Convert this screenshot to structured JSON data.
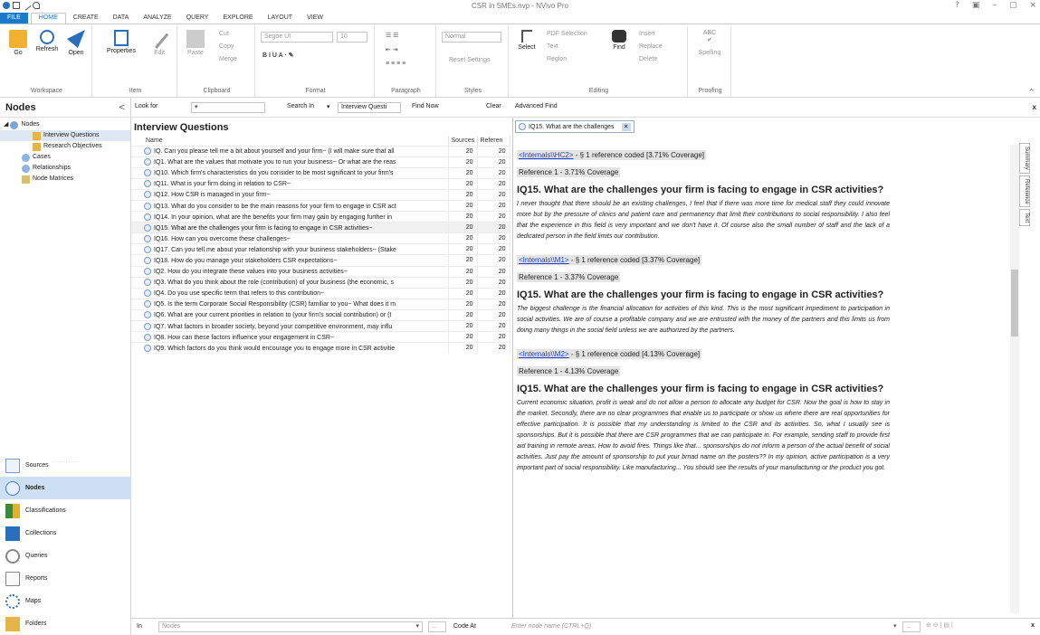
{
  "window": {
    "title": "CSR in SMEs.nvp - NVivo Pro",
    "controls": [
      "?",
      "▣",
      "–",
      "▢",
      "×"
    ]
  },
  "tabs": [
    "FILE",
    "HOME",
    "CREATE",
    "DATA",
    "ANALYZE",
    "QUERY",
    "EXPLORE",
    "LAYOUT",
    "VIEW"
  ],
  "ribbon": {
    "workspace": {
      "label": "Workspace",
      "go": "Go",
      "refresh": "Refresh",
      "open": "Open"
    },
    "item": {
      "label": "Item",
      "properties": "Properties",
      "edit": "Edit"
    },
    "clipboard": {
      "label": "Clipboard",
      "paste": "Paste",
      "cut": "Cut",
      "copy": "Copy",
      "merge": "Merge"
    },
    "format": {
      "label": "Format",
      "font": "Segoe UI",
      "size": "10"
    },
    "paragraph": {
      "label": "Paragraph"
    },
    "styles": {
      "label": "Styles",
      "style": "Normal",
      "reset": "Reset Settings"
    },
    "editing": {
      "label": "Editing",
      "select": "Select",
      "pdf_selection": "PDF Selection",
      "text": "Text",
      "region": "Region",
      "find": "Find",
      "insert": "Insert",
      "replace": "Replace",
      "delete": "Delete"
    },
    "proofing": {
      "label": "Proofing",
      "spelling": "Spelling",
      "abc": "ABC"
    }
  },
  "nav": {
    "title": "Nodes",
    "tree": [
      {
        "label": "Nodes",
        "level": 0
      },
      {
        "label": "Interview Questions",
        "level": 2
      },
      {
        "label": "Research Objectives",
        "level": 2
      },
      {
        "label": "Cases",
        "level": 1
      },
      {
        "label": "Relationships",
        "level": 1
      },
      {
        "label": "Node Matrices",
        "level": 1
      }
    ],
    "buttons": [
      "Sources",
      "Nodes",
      "Classifications",
      "Collections",
      "Queries",
      "Reports",
      "Maps",
      "Folders"
    ]
  },
  "findbar": {
    "look_for": "Look for",
    "search_in": "Search In",
    "search_value": "Interview Questi",
    "find_now": "Find Now",
    "clear": "Clear",
    "advanced": "Advanced Find",
    "close": "x"
  },
  "list": {
    "title": "Interview Questions",
    "columns": {
      "name": "Name",
      "sources": "Sources",
      "references": "Referen"
    },
    "rows": [
      {
        "name": "IQ. Can you please tell me a bit about yourself and your firm~ (I will make sure that all",
        "sources": "20",
        "refs": "20"
      },
      {
        "name": "IQ1. What are the values that motivate you to run your business~ Or what are the reas",
        "sources": "20",
        "refs": "20"
      },
      {
        "name": "IQ10. Which firm's characteristics do you consider to be most significant to your firm's",
        "sources": "20",
        "refs": "20"
      },
      {
        "name": "IQ11. What is your firm doing in relation to CSR~",
        "sources": "20",
        "refs": "20"
      },
      {
        "name": "IQ12. How CSR is managed in your firm~",
        "sources": "20",
        "refs": "20"
      },
      {
        "name": "IQ13. What do you consider to be the main reasons for your firm to engage in CSR act",
        "sources": "20",
        "refs": "20"
      },
      {
        "name": "IQ14. In your opinion, what are the benefits your firm may gain by engaging further in",
        "sources": "20",
        "refs": "20"
      },
      {
        "name": "IQ15. What are the challenges your firm is facing to engage in CSR activities~",
        "sources": "20",
        "refs": "20"
      },
      {
        "name": "IQ16. How can you overcome these challenges~",
        "sources": "20",
        "refs": "20"
      },
      {
        "name": "IQ17. Can you tell me about your relationship with your business stakeholders~ (Stake",
        "sources": "20",
        "refs": "20"
      },
      {
        "name": "IQ18. How do you manage your stakeholders CSR expectations~",
        "sources": "20",
        "refs": "20"
      },
      {
        "name": "IQ2. How do you integrate these values into your business activities~",
        "sources": "20",
        "refs": "20"
      },
      {
        "name": "IQ3. What do you think about the role (contribution) of your business (the economic, s",
        "sources": "20",
        "refs": "20"
      },
      {
        "name": "IQ4. Do you use specific term that refers to this contribution~",
        "sources": "20",
        "refs": "20"
      },
      {
        "name": "IQ5. Is the term Corporate Social Responsibility (CSR) familiar to you~ What does it m",
        "sources": "20",
        "refs": "20"
      },
      {
        "name": "IQ6. What are your current priorities in relation to (your firm's social contribution) or (t",
        "sources": "20",
        "refs": "20"
      },
      {
        "name": "IQ7. What factors in broader society, beyond your competitive environment, may influ",
        "sources": "20",
        "refs": "20"
      },
      {
        "name": "IQ8. How can these factors influence your engagement in CSR~",
        "sources": "20",
        "refs": "20"
      },
      {
        "name": "IQ9. Which factors do you think would encourage you to engage more in CSR activitie",
        "sources": "20",
        "refs": "20"
      }
    ]
  },
  "detail": {
    "tab_label": "IQ15. What are the challenges",
    "side_tabs": [
      "Summary",
      "Reference",
      "Text"
    ],
    "blocks": [
      {
        "link": "<Internals\\\\HC2>",
        "coded": " - § 1 reference coded  [3.71% Coverage]",
        "ref": "Reference 1 - 3.71% Coverage",
        "heading": "IQ15. What are the challenges your firm is facing to engage in CSR activities?",
        "text": "I never thought that there should be an existing challenges, I feel that if there was more time for medical staff they could innovate more but by the pressure of clinics and patient care and permanency that limit their contributions to social responsibility. I also feel that the experience in this field is very important and we don't have it. Of course also the small number of staff and the lack of a dedicated person in the field limits our contribution."
      },
      {
        "link": "<Internals\\\\M1>",
        "coded": " - § 1 reference coded  [3.37% Coverage]",
        "ref": "Reference 1 - 3.37% Coverage",
        "heading": "IQ15. What are the challenges your firm is facing to engage in CSR activities?",
        "text": "The biggest challenge is the financial allocation for activities of this kind. This is the most significant impediment to participation in social activities. We are of course a profitable company and we are entrusted with the money of the partners and this limits us from doing many things in the social field unless we are authorized by the partners."
      },
      {
        "link": "<Internals\\\\M2>",
        "coded": " - § 1 reference coded  [4.13% Coverage]",
        "ref": "Reference 1 - 4.13% Coverage",
        "heading": "IQ15. What are the challenges your firm is facing to engage in CSR activities?",
        "text": "Current economic situation, profit is weak and do not allow a person to allocate any budget for CSR. Now the goal is how to stay in the market. Secondly, there are no clear programmes that enable us to participate or show us where there are real opportunities for effective participation. It is possible that my understanding is limited to the CSR and its activities. So, what I usually see is sponsorships. But it is possible that there are CSR programmes that we can participate in. For example, sending staff to provide first aid training in remote areas. How to avoid fires. Things like that... sponsorships do not inform a person of the actual benefit of social activities. Just pay the amount of sponsorship to put your brnad name on the posters?? In my opinion, active participation is a very important part of social responsibility. Like manufacturing... You should see the results of your manufacturing or the product you got."
      }
    ]
  },
  "bottombar": {
    "in": "In",
    "nodes": "Nodes",
    "code_at": "Code At",
    "node_placeholder": "Enter node name (CTRL+Q)",
    "dots": "...",
    "close": "x"
  }
}
